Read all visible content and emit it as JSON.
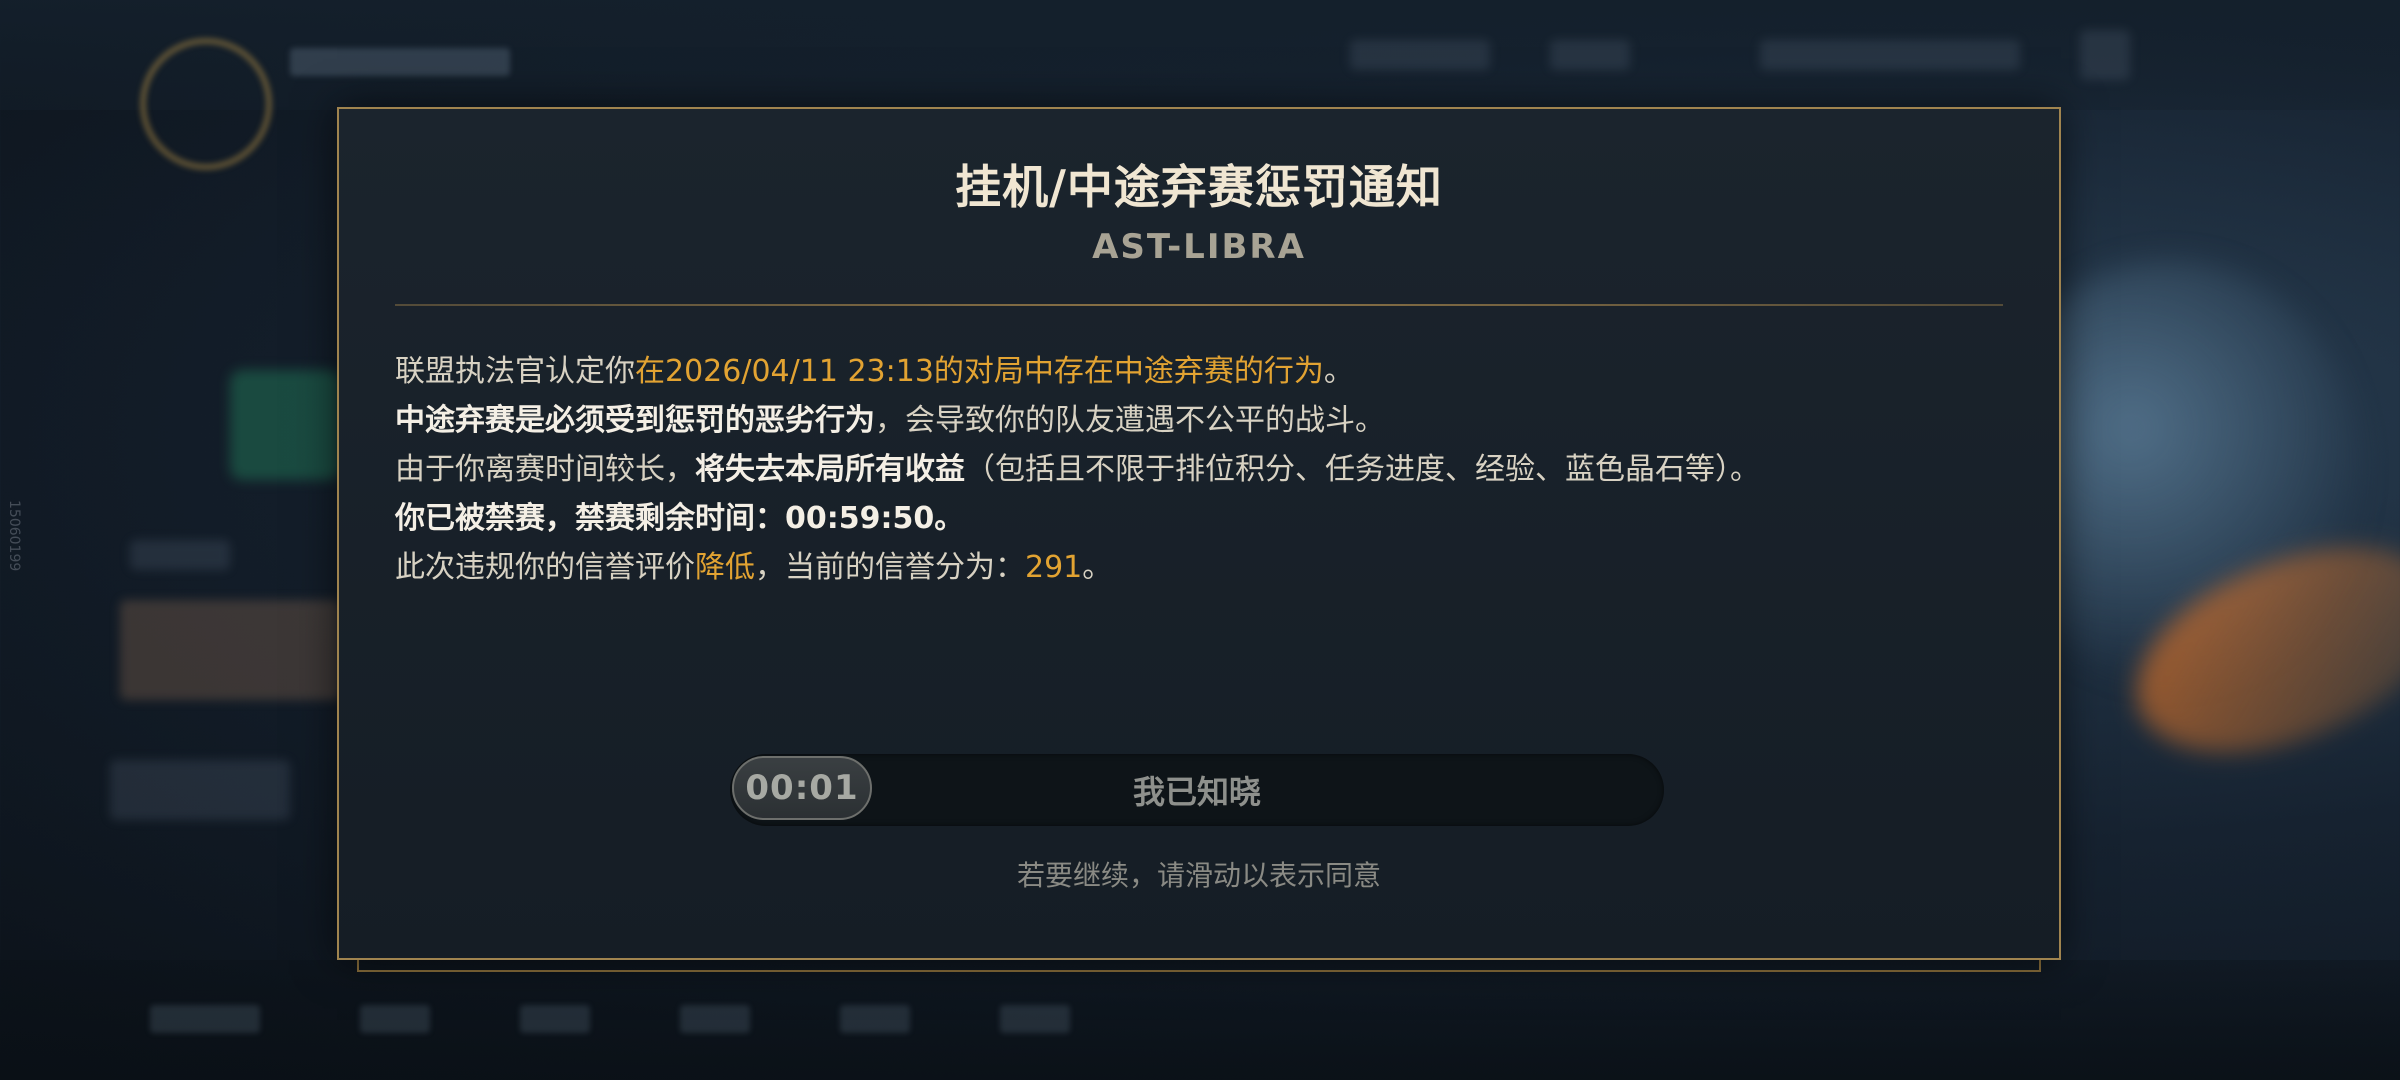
{
  "dialog": {
    "title": "挂机/中途弃赛惩罚通知",
    "subtitle": "AST-LIBRA",
    "body": {
      "line1": {
        "prefix": "联盟执法官认定你",
        "highlight": "在2026/04/11 23:13的对局中存在中途弃赛的行为",
        "suffix": "。"
      },
      "line2": {
        "strong": "中途弃赛是必须受到惩罚的恶劣行为",
        "rest": "，会导致你的队友遭遇不公平的战斗。"
      },
      "line3": {
        "prefix": "由于你离赛时间较长，",
        "strong": "将失去本局所有收益",
        "rest": "（包括且不限于排位积分、任务进度、经验、蓝色晶石等）。"
      },
      "line4": {
        "strong": "你已被禁赛，禁赛剩余时间：00:59:50。"
      },
      "line5": {
        "prefix": "此次违规你的信誉评价",
        "highlight1": "降低",
        "middle": "，当前的信誉分为：",
        "highlight2": "291",
        "suffix": "。"
      }
    },
    "slider": {
      "timer": "00:01",
      "label": "我已知晓"
    },
    "hint": "若要继续，请滑动以表示同意"
  },
  "background": {
    "side_code": "15060199"
  },
  "colors": {
    "accent_gold": "#a0844f",
    "highlight": "#e2a332",
    "dialog_bg": "#1b242d"
  }
}
